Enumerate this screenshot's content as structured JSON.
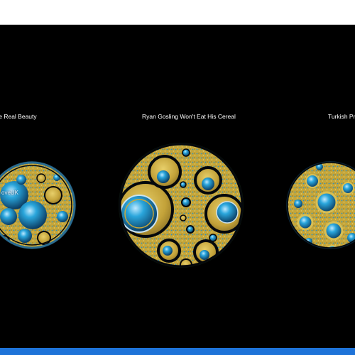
{
  "window": {
    "top_bar_color": "#ffffff",
    "bottom_bar_color": "#1e73d8",
    "background": "#000000"
  },
  "gallery": {
    "items": [
      {
        "title": "ve Real Beauty",
        "overlay": "oveUK"
      },
      {
        "title": "Ryan Gosling Won't Eat His Cereal",
        "overlay": ""
      },
      {
        "title": "Turkish Pr",
        "overlay": ""
      }
    ]
  },
  "colors": {
    "gold": "#c9a93c",
    "gold_light": "#e0c45a",
    "blue": "#1f9fd6",
    "blue_dark": "#0b4f7a",
    "outline": "#05080c"
  }
}
